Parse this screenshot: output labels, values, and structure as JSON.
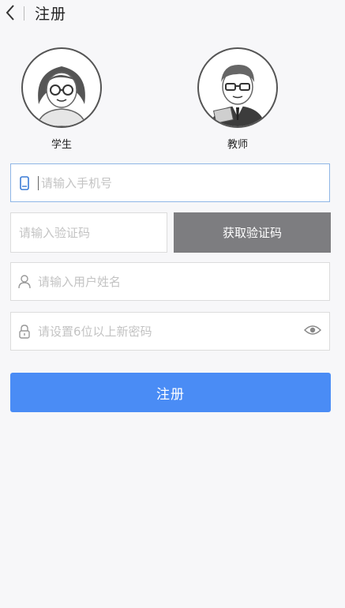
{
  "header": {
    "title": "注册"
  },
  "roles": [
    {
      "label": "学生"
    },
    {
      "label": "教师"
    }
  ],
  "form": {
    "phone_placeholder": "请输入手机号",
    "code_placeholder": "请输入验证码",
    "get_code_label": "获取验证码",
    "name_placeholder": "请输入用户姓名",
    "password_placeholder": "请设置6位以上新密码",
    "submit_label": "注册"
  },
  "colors": {
    "primary": "#4a8cf5",
    "code_button": "#7d7d80",
    "background": "#f7f7f9"
  }
}
